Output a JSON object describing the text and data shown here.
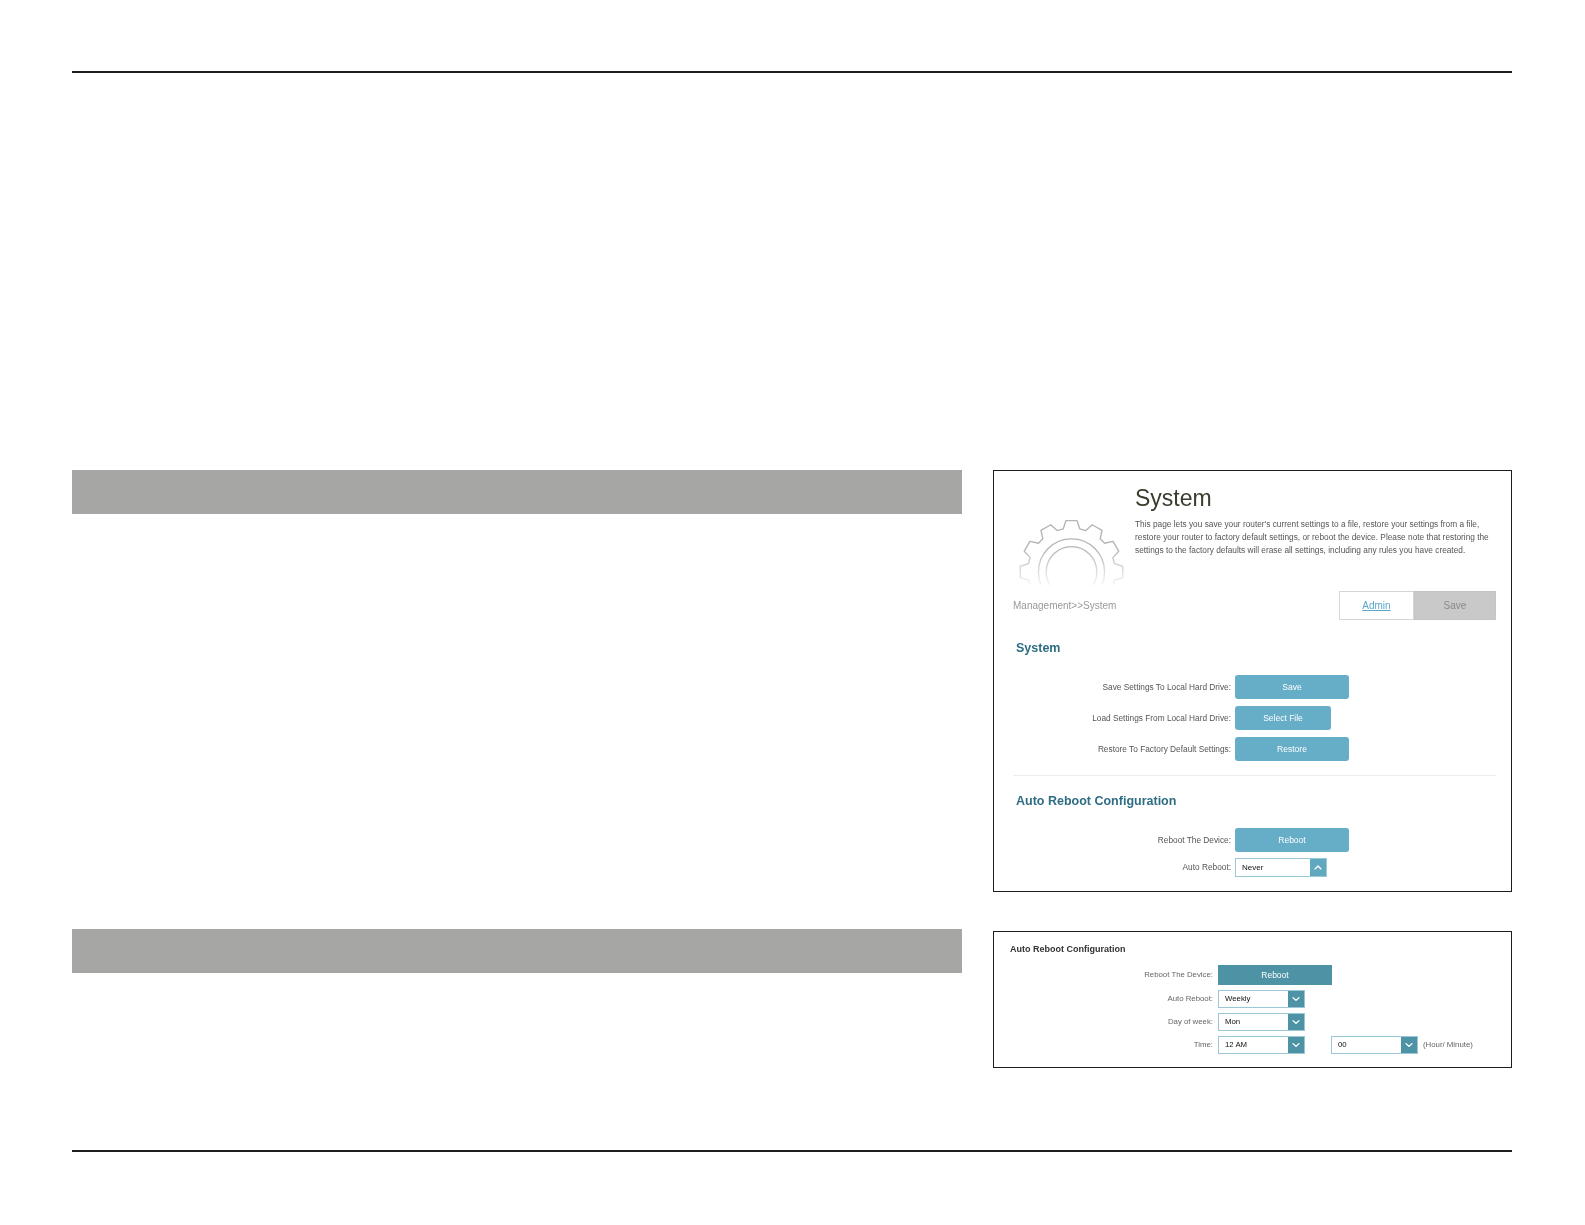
{
  "screenshots": [
    {
      "title": "System",
      "description": "This page lets you save your router's current settings to a file, restore your settings from a file, restore your router to factory default settings, or reboot the device. Please note that restoring the settings to the factory defaults will erase all settings, including any rules you have created.",
      "breadcrumb": "Management>>System",
      "header_actions": [
        {
          "kind": "link",
          "label": "Admin"
        },
        {
          "kind": "button",
          "label": "Save",
          "disabled": true
        }
      ],
      "sections": [
        {
          "title": "System",
          "rows": [
            {
              "kind": "button",
              "label": "Save Settings To Local Hard Drive:",
              "button": "Save",
              "hovered": false
            },
            {
              "kind": "file_button",
              "label": "Load Settings From Local Hard Drive:",
              "button": "Select File",
              "hovered": false
            },
            {
              "kind": "button",
              "label": "Restore To Factory Default Settings:",
              "button": "Restore",
              "hovered": false
            }
          ]
        },
        {
          "title": "Auto Reboot Configuration",
          "rows": [
            {
              "kind": "button",
              "label": "Reboot The Device:",
              "button": "Reboot",
              "hovered": false
            },
            {
              "kind": "select",
              "label": "Auto Reboot:",
              "selects": [
                {
                  "value": "Never",
                  "expanded": true
                }
              ]
            }
          ]
        }
      ]
    },
    {
      "sections": [
        {
          "title": "Auto Reboot Configuration",
          "rows": [
            {
              "kind": "button",
              "label": "Reboot The Device:",
              "button": "Reboot",
              "hovered": true
            },
            {
              "kind": "select",
              "label": "Auto Reboot:",
              "selects": [
                {
                  "value": "Weekly",
                  "expanded": false
                }
              ]
            },
            {
              "kind": "select",
              "label": "Day of week:",
              "selects": [
                {
                  "value": "Mon",
                  "expanded": false
                }
              ]
            },
            {
              "kind": "select",
              "label": "Time:",
              "selects": [
                {
                  "value": "12 AM",
                  "expanded": false
                },
                {
                  "value": "00",
                  "expanded": false
                }
              ],
              "hint": "(Hour/ Minute)"
            }
          ]
        }
      ]
    }
  ]
}
